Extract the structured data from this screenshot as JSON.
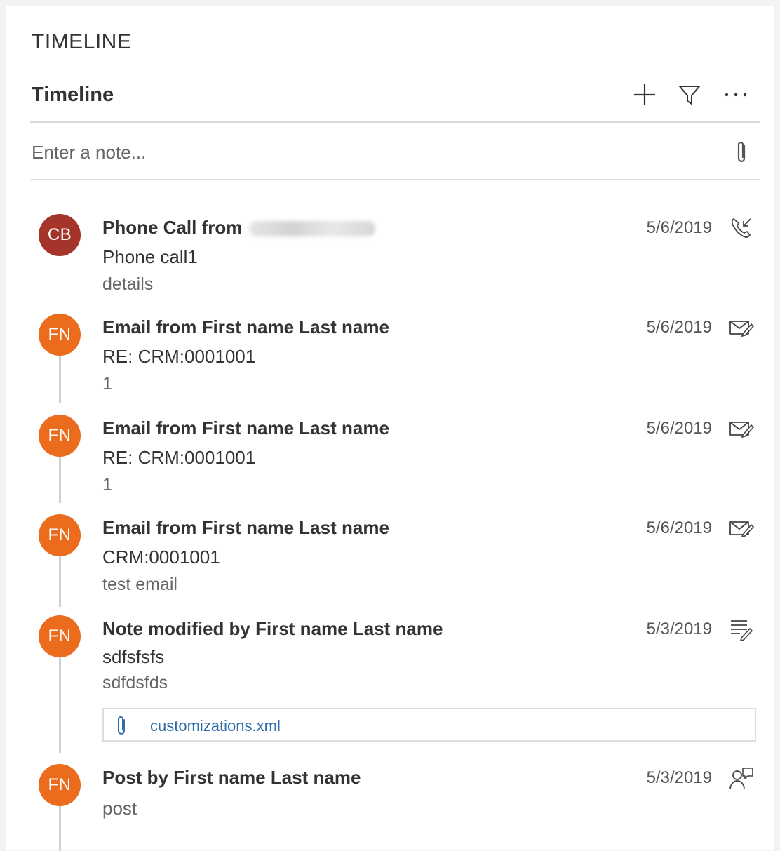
{
  "section_title": "TIMELINE",
  "timeline": {
    "label": "Timeline",
    "add_icon": "plus-icon",
    "filter_icon": "filter-icon",
    "more_icon": "more-icon"
  },
  "note": {
    "placeholder": "Enter a note...",
    "attach_icon": "paperclip-icon"
  },
  "colors": {
    "avatar_cb": "#a5342a",
    "avatar_fn": "#ea6c1c",
    "link": "#2f6ea8"
  },
  "items": [
    {
      "initials": "CB",
      "title": "Phone Call from",
      "subject": "Phone call1",
      "description": "details",
      "date": "5/6/2019",
      "icon": "phone-call-icon"
    },
    {
      "initials": "FN",
      "title": "Email from First name Last name",
      "subject": "RE: CRM:0001001",
      "description": "1",
      "date": "5/6/2019",
      "icon": "email-icon"
    },
    {
      "initials": "FN",
      "title": "Email from First name Last name",
      "subject": "RE: CRM:0001001",
      "description": "1",
      "date": "5/6/2019",
      "icon": "email-icon"
    },
    {
      "initials": "FN",
      "title": "Email from First name Last name",
      "subject": "CRM:0001001",
      "description": "test email",
      "date": "5/6/2019",
      "icon": "email-icon"
    },
    {
      "initials": "FN",
      "title": "Note modified by First name Last name",
      "subject": "sdfsfsfs",
      "description": "sdfdsfds",
      "date": "5/3/2019",
      "icon": "note-icon",
      "attachment": "customizations.xml"
    },
    {
      "initials": "FN",
      "title": "Post by First name Last name",
      "subject": "post",
      "date": "5/3/2019",
      "icon": "post-icon"
    }
  ]
}
